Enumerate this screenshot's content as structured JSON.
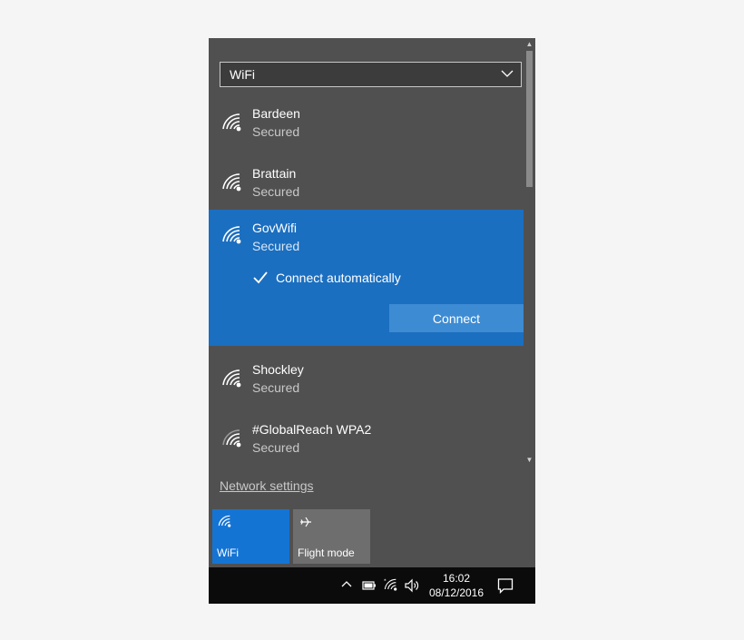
{
  "dropdown": {
    "value": "WiFi"
  },
  "networks": [
    {
      "name": "Bardeen",
      "status": "Secured"
    },
    {
      "name": "Brattain",
      "status": "Secured"
    },
    {
      "name": "GovWifi",
      "status": "Secured",
      "connect_automatically": "Connect automatically",
      "connect_label": "Connect"
    },
    {
      "name": "Shockley",
      "status": "Secured"
    },
    {
      "name": "#GlobalReach WPA2",
      "status": "Secured"
    }
  ],
  "network_settings_label": "Network settings",
  "quick_actions": [
    {
      "label": "WiFi",
      "icon": "wifi-icon",
      "active": true
    },
    {
      "label": "Flight mode",
      "icon": "airplane-icon",
      "active": false
    }
  ],
  "taskbar": {
    "time": "16:02",
    "date": "08/12/2016"
  },
  "colors": {
    "accent": "#1b6fc0",
    "panel": "#505050",
    "taskbar": "#0b0b0b"
  }
}
